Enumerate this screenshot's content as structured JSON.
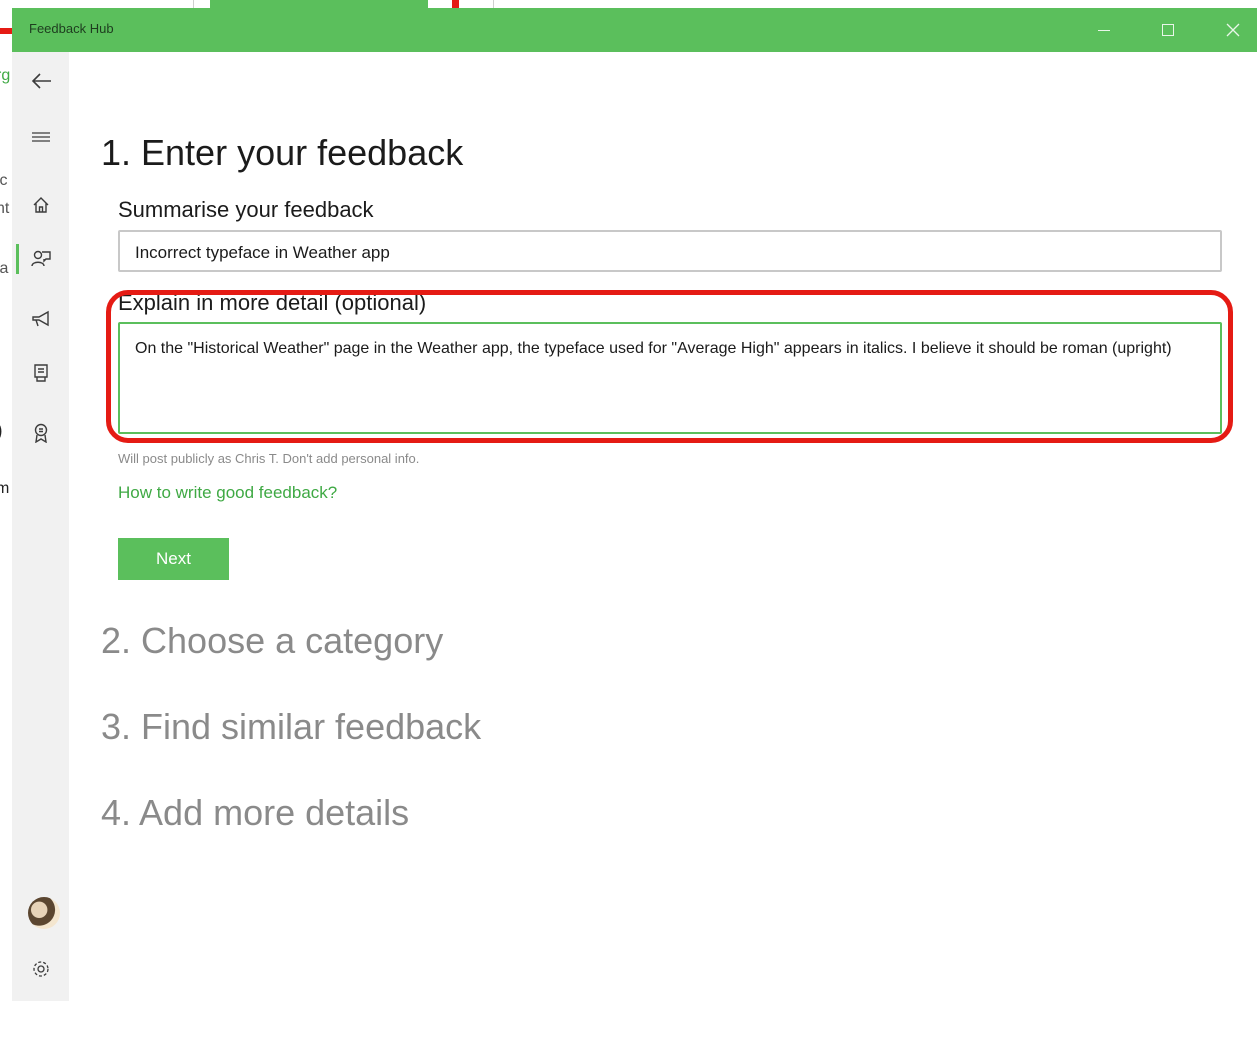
{
  "window": {
    "title": "Feedback Hub",
    "accent_color": "#5bbf5c",
    "highlight_color": "#e51b14"
  },
  "background_app": {
    "fragments": [
      "rg",
      "ic",
      "nt",
      "la",
      ")",
      "m"
    ]
  },
  "nav": {
    "items": [
      {
        "name": "back",
        "icon": "back-arrow-icon"
      },
      {
        "name": "menu",
        "icon": "hamburger-icon"
      },
      {
        "name": "home",
        "icon": "home-icon"
      },
      {
        "name": "feedback",
        "icon": "feedback-icon",
        "active": true
      },
      {
        "name": "announcements",
        "icon": "megaphone-icon"
      },
      {
        "name": "quests",
        "icon": "quests-icon"
      },
      {
        "name": "achievements",
        "icon": "badge-icon"
      },
      {
        "name": "profile",
        "icon": "avatar"
      },
      {
        "name": "settings",
        "icon": "gear-icon"
      }
    ]
  },
  "form": {
    "step1_title": "1. Enter your feedback",
    "summary_label": "Summarise your feedback",
    "summary_value": "Incorrect typeface in Weather app",
    "detail_label": "Explain in more detail (optional)",
    "detail_value": "On the \"Historical Weather\" page in the Weather app, the typeface used for \"Average High\" appears in italics. I believe it should be roman (upright)",
    "helper_text": "Will post publicly as Chris T. Don't add personal info.",
    "help_link": "How to write good feedback?",
    "next_label": "Next"
  },
  "steps": {
    "step2": "2. Choose a category",
    "step3": "3. Find similar feedback",
    "step4": "4. Add more details"
  }
}
